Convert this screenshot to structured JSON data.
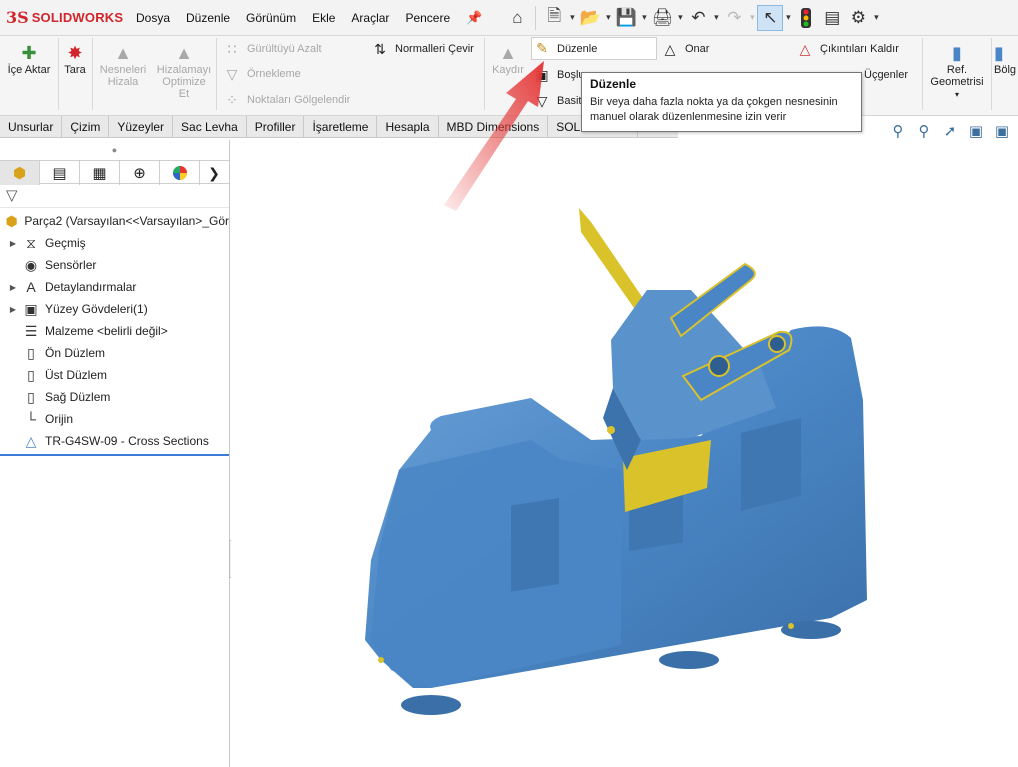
{
  "app": {
    "logo_ds": "3S",
    "logo_text": "SOLIDWORKS"
  },
  "menu": [
    "Dosya",
    "Düzenle",
    "Görünüm",
    "Ekle",
    "Araçlar",
    "Pencere"
  ],
  "ribbon": {
    "ice_aktar": "İçe Aktar",
    "tara": "Tara",
    "nesneleri_hizala_1": "Nesneleri",
    "nesneleri_hizala_2": "Hizala",
    "hizalamayi_1": "Hizalamayı",
    "hizalamayi_2": "Optimize",
    "hizalamayi_3": "Et",
    "gurultu": "Gürültüyü Azalt",
    "ornekleme": "Örnekleme",
    "noktalari": "Noktaları Gölgelendir",
    "normaller": "Normalleri Çevir",
    "kaydir": "Kaydır",
    "duzenle": "Düzenle",
    "bosluk": "Boşlu",
    "basit": "Basit",
    "onar": "Onar",
    "cikintilari": "Çıkıntıları Kaldır",
    "ucgenler": "Üçgenler",
    "ref_1": "Ref.",
    "ref_2": "Geometrisi",
    "bolge": "Bölg"
  },
  "tabs": [
    "Unsurlar",
    "Çizim",
    "Yüzeyler",
    "Sac Levha",
    "Profiller",
    "İşaretleme",
    "Hesapla",
    "MBD Dimensions",
    "SOLIDW"
  ],
  "tree": {
    "root": "Parça2  (Varsayılan<<Varsayılan>_Gör",
    "items": [
      {
        "label": "Geçmiş",
        "expand": true,
        "icon": "history-icon"
      },
      {
        "label": "Sensörler",
        "expand": false,
        "icon": "sensor-icon"
      },
      {
        "label": "Detaylandırmalar",
        "expand": true,
        "icon": "annotation-icon"
      },
      {
        "label": "Yüzey Gövdeleri(1)",
        "expand": true,
        "icon": "surface-bodies-icon"
      },
      {
        "label": "Malzeme <belirli değil>",
        "expand": false,
        "icon": "material-icon"
      },
      {
        "label": "Ön Düzlem",
        "expand": false,
        "icon": "plane-icon"
      },
      {
        "label": "Üst Düzlem",
        "expand": false,
        "icon": "plane-icon"
      },
      {
        "label": "Sağ Düzlem",
        "expand": false,
        "icon": "plane-icon"
      },
      {
        "label": "Orijin",
        "expand": false,
        "icon": "origin-icon"
      },
      {
        "label": "TR-G4SW-09 - Cross Sections",
        "expand": false,
        "icon": "mesh-icon"
      }
    ]
  },
  "tooltip": {
    "title": "Düzenle",
    "line1": "Bir veya daha fazla nokta ya da çokgen nesnesinin",
    "line2": "manuel olarak düzenlenmesine izin verir"
  },
  "colors": {
    "brand_red": "#d0262c",
    "model_blue": "#4a86c5",
    "model_yellow": "#d9c22a",
    "arrow_red": "#e53a3a"
  }
}
